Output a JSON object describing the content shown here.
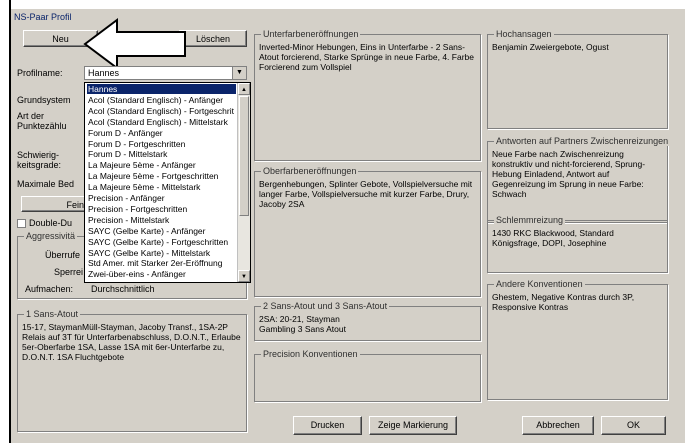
{
  "window": {
    "title": "NS-Paar Profil"
  },
  "buttons": {
    "neu": "Neu",
    "loeschen": "Löschen",
    "fein": "Fein",
    "drucken": "Drucken",
    "zeige_markierung": "Zeige Markierung",
    "abbrechen": "Abbrechen",
    "ok": "OK"
  },
  "left": {
    "profilname_label": "Profilname:",
    "profilname_value": "Hannes",
    "grundsystem_label": "Grundsystem",
    "art_label_1": "Art der",
    "art_label_2": "Punktezählu",
    "schwierig_label_1": "Schwierig-",
    "schwierig_label_2": "keitsgrade:",
    "maximale_label": "Maximale Bed",
    "double_label": "Double-Du",
    "aggressivitaet_label": "Aggressivitä",
    "ueberrufe_label": "Überrufe",
    "sperre_label": "Sperrei",
    "aufmachen_label": "Aufmachen:",
    "aufmachen_value": "Durchschnittlich"
  },
  "dropdown_items": [
    "Hannes",
    "Acol (Standard Englisch) - Anfänger",
    "Acol (Standard Englisch) - Fortgeschrit",
    "Acol (Standard Englisch) - Mittelstark",
    "Forum D - Anfänger",
    "Forum D - Fortgeschritten",
    "Forum D - Mittelstark",
    "La Majeure 5ème - Anfänger",
    "La Majeure 5ème - Fortgeschritten",
    "La Majeure 5ème - Mittelstark",
    "Precision - Anfänger",
    "Precision - Fortgeschritten",
    "Precision - Mittelstark",
    "SAYC (Gelbe Karte) - Anfänger",
    "SAYC (Gelbe Karte) - Fortgeschritten",
    "SAYC (Gelbe Karte) - Mittelstark",
    "Std Amer. mit Starker 2er-Eröffnung",
    "Zwei-über-eins - Anfänger"
  ],
  "groups": {
    "ein_sans_atout": {
      "title": "1 Sans-Atout",
      "text": "15-17, StaymanMüll-Stayman, Jacoby Transf., 1SA-2P Relais auf 3T für Unterfarbenabschluss, D.O.N.T., Erlaube 5er-Oberfarbe 1SA, Lasse 1SA mit 6er-Unterfarbe zu, D.O.N.T. 1SA Fluchtgebote"
    },
    "unterfarben": {
      "title": "Unterfarbeneröffnungen",
      "text": "Inverted-Minor Hebungen, Eins in Unterfarbe - 2 Sans-Atout forcierend, Starke Sprünge in neue Farbe, 4. Farbe Forcierend zum Vollspiel"
    },
    "oberfarben": {
      "title": "Oberfarbeneröffnungen",
      "text": "Bergenhebungen, Splinter Gebote, Vollspielversuche mit langer Farbe, Vollspielversuche mit kurzer Farbe, Drury, Jacoby 2SA"
    },
    "zwei_drei_sa": {
      "title": "2 Sans-Atout und 3 Sans-Atout",
      "text": "2SA: 20-21, Stayman\nGambling 3 Sans Atout"
    },
    "precision": {
      "title": "Precision Konventionen",
      "text": ""
    },
    "hochansagen": {
      "title": "Hochansagen",
      "text": "Benjamin Zweiergebote, Ogust"
    },
    "antworten": {
      "title": "Antworten auf Partners Zwischenreizungen",
      "text": "Neue Farbe nach Zwischenreizung konstruktiv und nicht-forcierend, Sprung-Hebung Einladend, Antwort auf Gegenreizung im Sprung in neue Farbe: Schwach"
    },
    "schlemm": {
      "title": "Schlemmreizung",
      "text": "1430 RKC Blackwood, Standard Königsfrage, DOPI, Josephine"
    },
    "andere": {
      "title": "Andere Konventionen",
      "text": "Ghestem, Negative Kontras durch  3P, Responsive Kontras"
    }
  },
  "icons": {
    "combo_arrow": "chevron-down-icon",
    "pointer": "arrow-pointer-icon"
  },
  "colors": {
    "face": "#d4d0c8",
    "selection": "#0a246a"
  }
}
